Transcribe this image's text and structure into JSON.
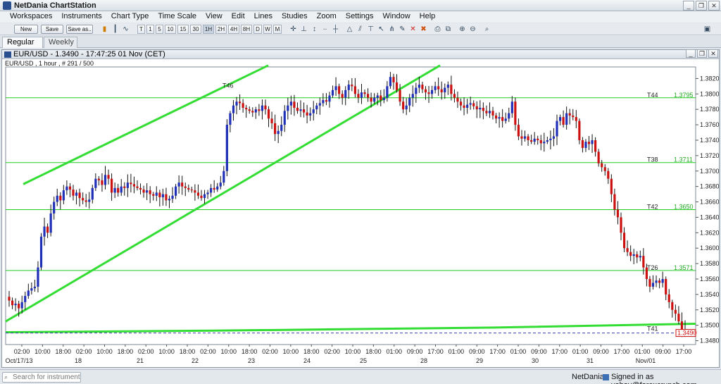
{
  "window": {
    "title": "NetDania ChartStation"
  },
  "menu": [
    "Workspaces",
    "Instruments",
    "Chart Type",
    "Time Scale",
    "View",
    "Edit",
    "Lines",
    "Studies",
    "Zoom",
    "Settings",
    "Window",
    "Help"
  ],
  "toolbar": {
    "new_label": "New",
    "save_label": "Save",
    "save_as_label": "Save as..",
    "timescales": [
      "T",
      "1",
      "5",
      "10",
      "15",
      "30",
      "1H",
      "2H",
      "4H",
      "8H",
      "D",
      "W",
      "M"
    ]
  },
  "tabs": [
    {
      "label": "Regular",
      "pin": "✱"
    },
    {
      "label": "Weekly"
    }
  ],
  "chart_window": {
    "title": "EUR/USD - 1.3490 - 17:47:25  01 Nov (CET)",
    "subtitle": "EUR/USD , 1 hour , # 291 / 500"
  },
  "chart_data": {
    "type": "candlestick",
    "instrument": "EUR/USD",
    "interval": "1 hour",
    "ylim": [
      1.3475,
      1.3835
    ],
    "y_ticks": [
      1.348,
      1.35,
      1.352,
      1.354,
      1.356,
      1.358,
      1.36,
      1.362,
      1.364,
      1.366,
      1.368,
      1.37,
      1.372,
      1.374,
      1.376,
      1.378,
      1.38,
      1.382
    ],
    "x_time_labels": [
      "02:00",
      "10:00",
      "18:00",
      "02:00",
      "10:00",
      "18:00",
      "02:00",
      "10:00",
      "18:00",
      "02:00",
      "10:00",
      "18:00",
      "02:00",
      "10:00",
      "18:00",
      "02:00",
      "10:00",
      "18:00",
      "01:00",
      "09:00",
      "17:00",
      "01:00",
      "09:00",
      "17:00",
      "01:00",
      "09:00",
      "17:00",
      "01:00",
      "09:00",
      "17:00",
      "01:00",
      "09:00",
      "17:00"
    ],
    "x_date_labels": [
      "Oct/17/13",
      "18",
      "21",
      "22",
      "23",
      "24",
      "25",
      "28",
      "29",
      "30",
      "31",
      "Nov/01"
    ],
    "horizontal_levels": [
      {
        "label": "T44",
        "value": 1.3795,
        "value_label": "1.3795"
      },
      {
        "label": "T38",
        "value": 1.3711,
        "value_label": "1.3711"
      },
      {
        "label": "T42",
        "value": 1.365,
        "value_label": "1.3650"
      },
      {
        "label": "T26",
        "value": 1.3571,
        "value_label": "1.3571"
      },
      {
        "label": "T41",
        "value": 1.3492,
        "value_label": ""
      }
    ],
    "trendline_label": "T46",
    "last_price": 1.349,
    "last_price_label": "1.3490",
    "closes": [
      1.3532,
      1.3526,
      1.3528,
      1.3522,
      1.353,
      1.3538,
      1.3545,
      1.3548,
      1.355,
      1.3575,
      1.3615,
      1.3628,
      1.362,
      1.3645,
      1.366,
      1.3668,
      1.3662,
      1.3675,
      1.368,
      1.3676,
      1.3668,
      1.3672,
      1.3665,
      1.3662,
      1.366,
      1.3663,
      1.3678,
      1.369,
      1.3688,
      1.3682,
      1.3695,
      1.369,
      1.3672,
      1.3678,
      1.3672,
      1.368,
      1.3678,
      1.3685,
      1.3683,
      1.368,
      1.3678,
      1.3676,
      1.3672,
      1.3675,
      1.367,
      1.3668,
      1.3672,
      1.3666,
      1.367,
      1.3662,
      1.3664,
      1.3668,
      1.368,
      1.3685,
      1.368,
      1.3678,
      1.3676,
      1.3675,
      1.3672,
      1.3668,
      1.3665,
      1.367,
      1.3672,
      1.3678,
      1.3676,
      1.368,
      1.3685,
      1.37,
      1.376,
      1.3775,
      1.3785,
      1.379,
      1.3788,
      1.3782,
      1.378,
      1.3778,
      1.3776,
      1.378,
      1.3778,
      1.3785,
      1.378,
      1.3768,
      1.3762,
      1.3748,
      1.3752,
      1.376,
      1.3778,
      1.3785,
      1.379,
      1.3782,
      1.3778,
      1.378,
      1.3776,
      1.3772,
      1.3775,
      1.378,
      1.3785,
      1.3788,
      1.3792,
      1.379,
      1.3798,
      1.3805,
      1.381,
      1.38,
      1.3795,
      1.3805,
      1.3812,
      1.381,
      1.38,
      1.3795,
      1.3802,
      1.38,
      1.3795,
      1.379,
      1.3795,
      1.3798,
      1.3792,
      1.3795,
      1.381,
      1.3822,
      1.3815,
      1.3805,
      1.379,
      1.378,
      1.3785,
      1.3795,
      1.38,
      1.3808,
      1.3812,
      1.3806,
      1.3802,
      1.38,
      1.3805,
      1.381,
      1.3806,
      1.3802,
      1.3808,
      1.3812,
      1.38,
      1.3795,
      1.379,
      1.3785,
      1.3782,
      1.3786,
      1.3788,
      1.3784,
      1.378,
      1.3782,
      1.3778,
      1.3775,
      1.3778,
      1.3772,
      1.3768,
      1.377,
      1.3765,
      1.3768,
      1.3775,
      1.379,
      1.376,
      1.3745,
      1.3742,
      1.3745,
      1.374,
      1.3738,
      1.3742,
      1.374,
      1.3736,
      1.3738,
      1.374,
      1.3742,
      1.3745,
      1.3765,
      1.377,
      1.376,
      1.3775,
      1.3772,
      1.377,
      1.3765,
      1.374,
      1.373,
      1.3738,
      1.3735,
      1.374,
      1.3725,
      1.371,
      1.3705,
      1.37,
      1.369,
      1.367,
      1.365,
      1.364,
      1.362,
      1.36,
      1.3595,
      1.359,
      1.3592,
      1.3588,
      1.359,
      1.3575,
      1.356,
      1.355,
      1.3555,
      1.3558,
      1.3555,
      1.356,
      1.354,
      1.353,
      1.352,
      1.3515,
      1.3505,
      1.3495,
      1.349
    ]
  },
  "status": {
    "search_placeholder": "Search for instrument",
    "brand": "NetDania",
    "signed_in": "Signed in as yohay@forexcrunch.com"
  },
  "colors": {
    "candle_up": "#1f2fb8",
    "candle_down": "#cc1010",
    "level_line": "#22cc22",
    "trend_line": "#33dd33"
  }
}
